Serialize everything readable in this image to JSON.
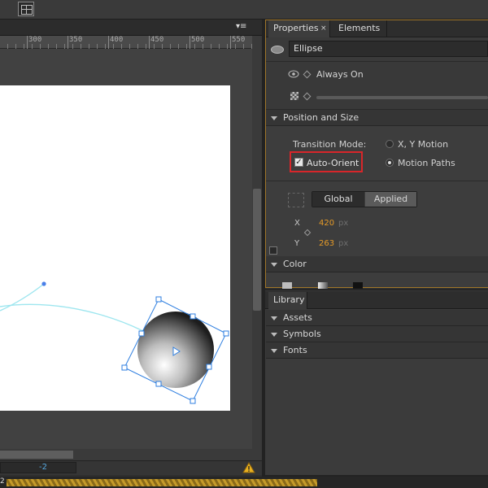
{
  "ruler": {
    "ticks": [
      "300",
      "350",
      "400",
      "450",
      "500",
      "550"
    ]
  },
  "status": {
    "value": "-2"
  },
  "properties_panel": {
    "tabs": {
      "properties": "Properties",
      "properties_close": "×",
      "elements": "Elements"
    },
    "element_name": "Ellipse",
    "visibility": "Always On",
    "sections": {
      "position_and_size": "Position and Size",
      "color": "Color"
    },
    "transition_mode_label": "Transition Mode:",
    "radio_xy": "X, Y Motion",
    "radio_motion_paths": "Motion Paths",
    "motion_mode_selected": "Motion Paths",
    "auto_orient_label": "Auto-Orient",
    "auto_orient_checked": true,
    "auto_orient_mark": "✓",
    "coord_buttons": {
      "global": "Global",
      "applied": "Applied"
    },
    "x_label": "X",
    "x_value": "420",
    "y_label": "Y",
    "y_value": "263",
    "unit": "px"
  },
  "library_panel": {
    "tab": "Library",
    "sections": [
      "Assets",
      "Symbols",
      "Fonts"
    ]
  },
  "bottom": {
    "label": "2"
  },
  "colors": {
    "accent_orange": "#e49a28",
    "highlight_red": "#d8262a",
    "path_cyan": "#9ee6ef",
    "handle_blue": "#2f7fe0"
  }
}
